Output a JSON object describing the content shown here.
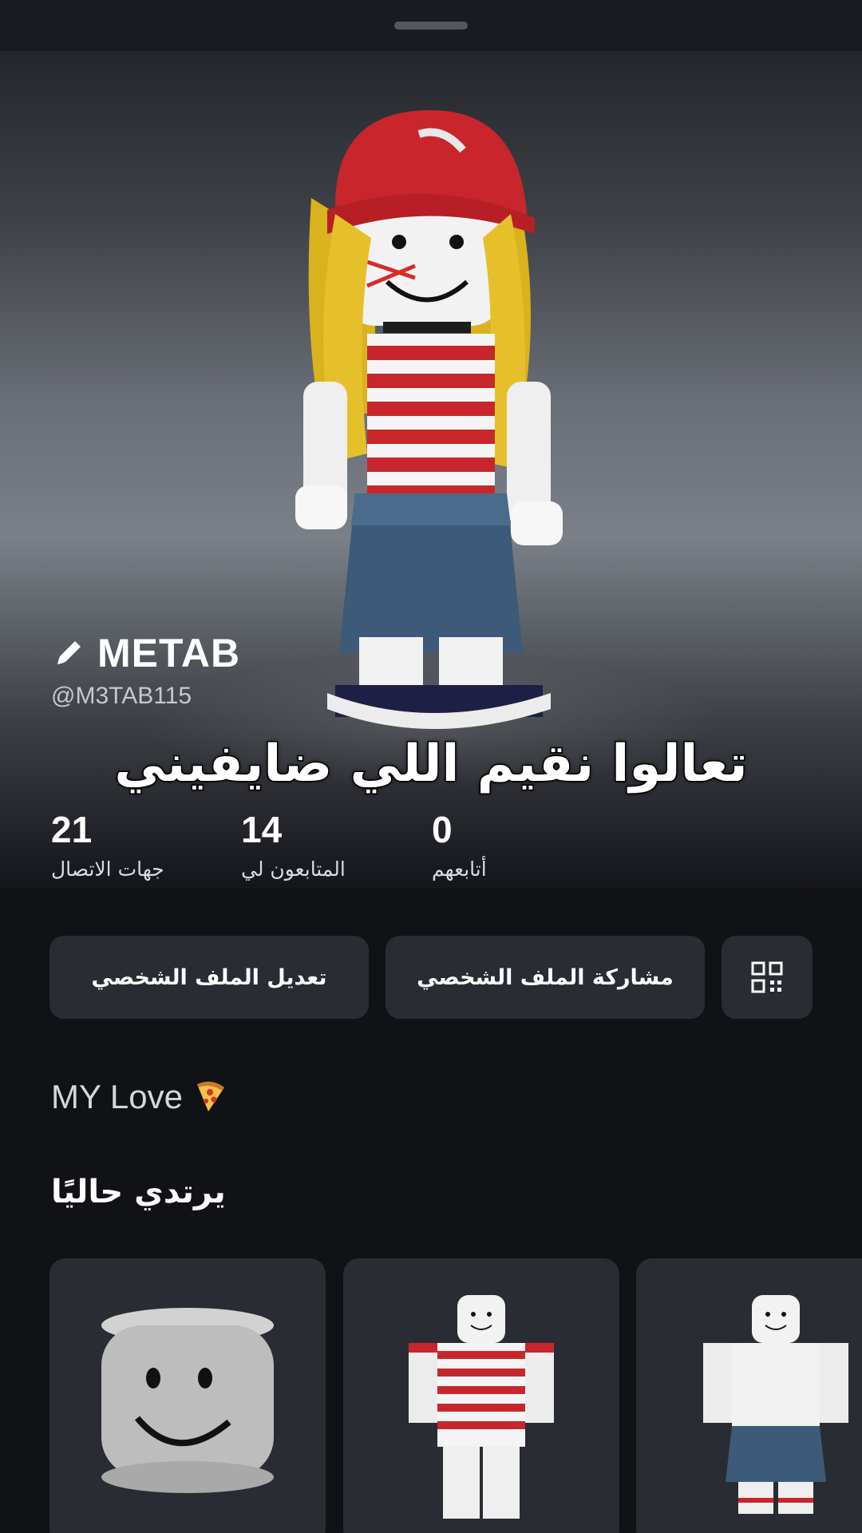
{
  "profile": {
    "display_name": "METAB",
    "username": "@M3TAB115",
    "bio": "MY Love",
    "bio_emoji_icon": "pizza-icon"
  },
  "overlay_caption": "تعالوا نقيم اللي ضايفيني",
  "stats": [
    {
      "value": "21",
      "label": "جهات الاتصال"
    },
    {
      "value": "14",
      "label": "المتابعون لي"
    },
    {
      "value": "0",
      "label": "أتابعهم"
    }
  ],
  "actions": {
    "edit_profile": "تعديل الملف الشخصي",
    "share_profile": "مشاركة الملف الشخصي",
    "qr_icon": "qr-code-icon"
  },
  "wearing": {
    "title": "يرتدي حاليًا",
    "items": [
      "head-item",
      "striped-shirt-item",
      "denim-skirt-item"
    ]
  },
  "colors": {
    "background": "#111216",
    "card": "#2a2c33",
    "text": "#ffffff"
  }
}
